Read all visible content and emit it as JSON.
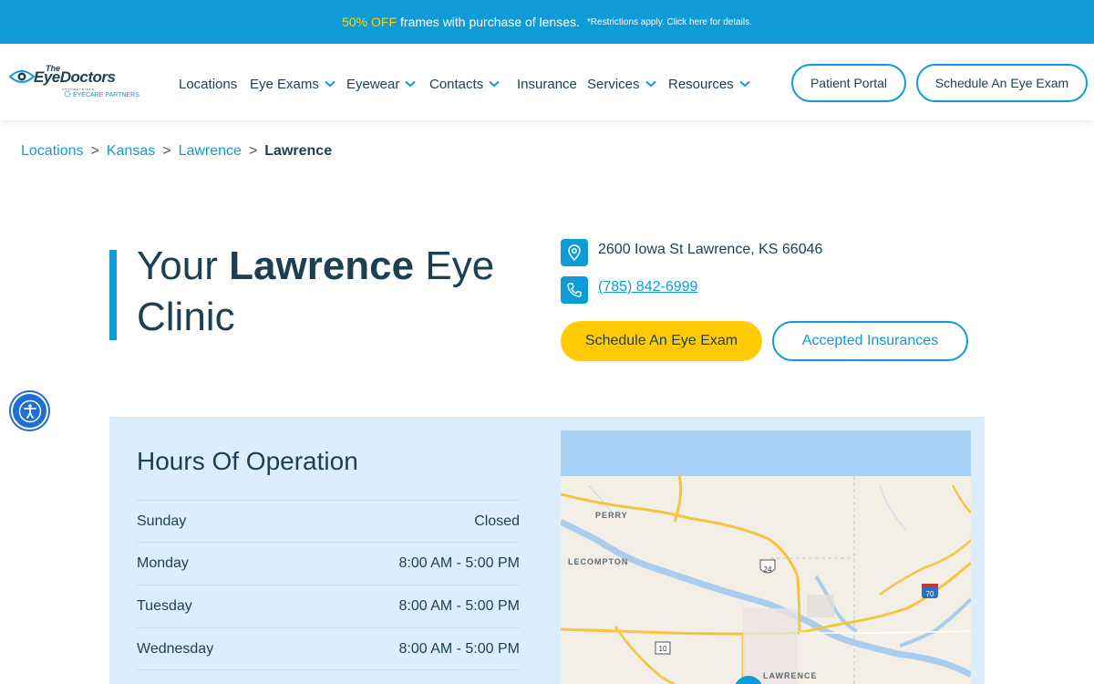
{
  "promo": {
    "highlight": "50% OFF",
    "text": "frames with purchase of lenses.",
    "fine_print": "*Restrictions apply. Click here for details."
  },
  "brand": {
    "logo_the": "The",
    "logo_main": "EyeDoctors",
    "logo_sub": "OPTOMETRISTS",
    "logo_partner": "EYECARE PARTNERS."
  },
  "nav": {
    "items": [
      {
        "label": "Locations",
        "has_dropdown": false
      },
      {
        "label": "Eye Exams",
        "has_dropdown": true
      },
      {
        "label": "Eyewear",
        "has_dropdown": true
      },
      {
        "label": "Contacts",
        "has_dropdown": true
      },
      {
        "label": "Insurance",
        "has_dropdown": false
      },
      {
        "label": "Services",
        "has_dropdown": true
      },
      {
        "label": "Resources",
        "has_dropdown": true
      }
    ],
    "patient_portal": "Patient Portal",
    "schedule": "Schedule An Eye Exam"
  },
  "breadcrumb": {
    "items": [
      "Locations",
      "Kansas",
      "Lawrence"
    ],
    "separator": ">",
    "current": "Lawrence"
  },
  "hero": {
    "title_pre": "Your ",
    "title_bold": "Lawrence",
    "title_post": " Eye Clinic",
    "address": "2600 Iowa St Lawrence, KS 66046",
    "phone": "(785) 842-6999",
    "schedule_button": "Schedule An Eye Exam",
    "insurance_button": "Accepted Insurances"
  },
  "hours": {
    "title": "Hours Of Operation",
    "rows": [
      {
        "day": "Sunday",
        "time": "Closed"
      },
      {
        "day": "Monday",
        "time": "8:00 AM - 5:00 PM"
      },
      {
        "day": "Tuesday",
        "time": "8:00 AM - 5:00 PM"
      },
      {
        "day": "Wednesday",
        "time": "8:00 AM - 5:00 PM"
      }
    ]
  },
  "map": {
    "labels": [
      "PERRY",
      "LECOMPTON",
      "LAWRENCE"
    ],
    "shields": [
      "24",
      "70",
      "10"
    ]
  },
  "colors": {
    "brand_blue": "#0e9bd7",
    "navy": "#1c3f52",
    "yellow": "#ffcb05",
    "panel": "#dcedfb"
  },
  "icons": [
    "eye-logo-icon",
    "chevron-down-icon",
    "map-pin-icon",
    "phone-icon",
    "accessibility-icon"
  ]
}
